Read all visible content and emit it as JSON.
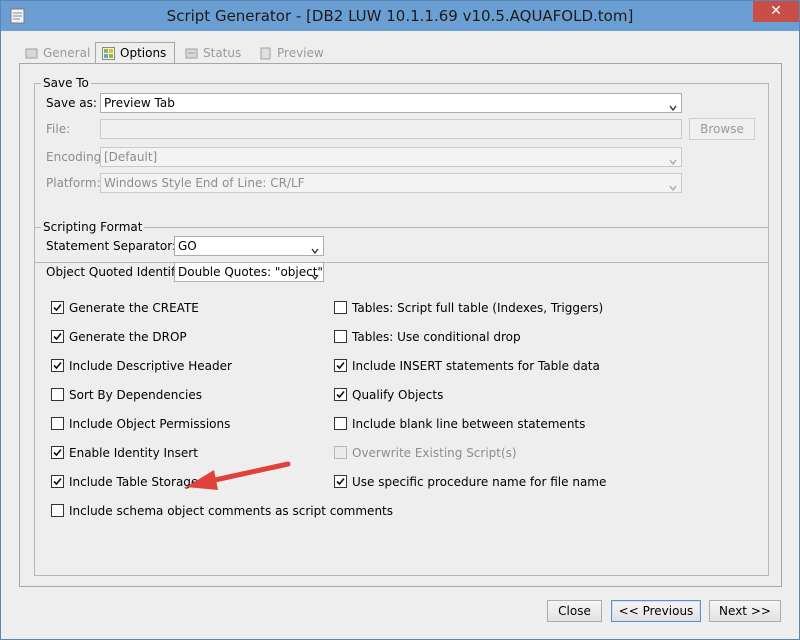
{
  "window": {
    "title": "Script Generator - [DB2 LUW 10.1.1.69 v10.5.AQUAFOLD.tom]",
    "close_glyph": "✕",
    "icons": {
      "app": "script-generator-icon",
      "close": "close-icon"
    }
  },
  "tabs": [
    {
      "label": "General",
      "active": false,
      "icon": "general-tab-icon"
    },
    {
      "label": "Options",
      "active": true,
      "icon": "options-tab-icon"
    },
    {
      "label": "Status",
      "active": false,
      "icon": "status-tab-icon"
    },
    {
      "label": "Preview",
      "active": false,
      "icon": "preview-tab-icon"
    }
  ],
  "save_to": {
    "legend": "Save To",
    "save_as": {
      "label": "Save as:",
      "value": "Preview Tab"
    },
    "file": {
      "label": "File:",
      "value": "",
      "browse_label": "Browse"
    },
    "encoding": {
      "label": "Encoding:",
      "value": "[Default]"
    },
    "platform": {
      "label": "Platform:",
      "value": "Windows Style End of Line: CR/LF"
    }
  },
  "scripting_format": {
    "legend": "Scripting Format",
    "statement_separator": {
      "label": "Statement Separator:",
      "value": "GO"
    },
    "quoted_identifier": {
      "label": "Object Quoted Identifier:",
      "value": "Double Quotes: \"object\""
    },
    "options_left": [
      {
        "label": "Generate the CREATE",
        "checked": true,
        "enabled": true
      },
      {
        "label": "Generate the DROP",
        "checked": true,
        "enabled": true
      },
      {
        "label": "Include Descriptive Header",
        "checked": true,
        "enabled": true
      },
      {
        "label": "Sort By Dependencies",
        "checked": false,
        "enabled": true
      },
      {
        "label": "Include Object Permissions",
        "checked": false,
        "enabled": true
      },
      {
        "label": "Enable Identity Insert",
        "checked": true,
        "enabled": true
      },
      {
        "label": "Include Table Storage",
        "checked": true,
        "enabled": true
      },
      {
        "label": "Include schema object comments as script comments",
        "checked": false,
        "enabled": true
      }
    ],
    "options_right": [
      {
        "label": "Tables: Script full table (Indexes, Triggers)",
        "checked": false,
        "enabled": true
      },
      {
        "label": "Tables: Use conditional drop",
        "checked": false,
        "enabled": true
      },
      {
        "label": "Include INSERT statements for Table data",
        "checked": true,
        "enabled": true
      },
      {
        "label": "Qualify Objects",
        "checked": true,
        "enabled": true
      },
      {
        "label": "Include blank line between statements",
        "checked": false,
        "enabled": true
      },
      {
        "label": "Overwrite Existing Script(s)",
        "checked": false,
        "enabled": false
      },
      {
        "label": "Use specific procedure name for file name",
        "checked": true,
        "enabled": true
      }
    ]
  },
  "footer": {
    "close_label": "Close",
    "previous_label": "<< Previous",
    "next_label": "Next >>"
  },
  "colors": {
    "titlebar": "#6b9fd4",
    "close": "#c74f48",
    "annotation_arrow": "#e0413a"
  },
  "annotation": {
    "icon": "red-arrow-icon",
    "points_to": "Include Table Storage"
  }
}
